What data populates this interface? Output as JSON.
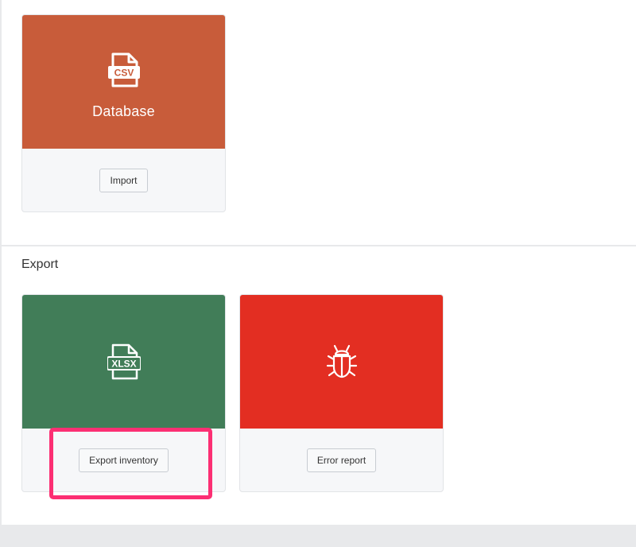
{
  "import_section": {
    "card": {
      "label": "Database",
      "icon_text": "CSV",
      "icon": "csv-file-icon",
      "color": "#c85c3a",
      "button_label": "Import"
    }
  },
  "export_section": {
    "title": "Export",
    "cards": [
      {
        "icon_text": "XLSX",
        "icon": "xlsx-file-icon",
        "color": "#417d58",
        "button_label": "Export inventory"
      },
      {
        "icon": "bug-icon",
        "color": "#e32e22",
        "button_label": "Error report"
      }
    ]
  },
  "highlight_color": "#fc2f73"
}
